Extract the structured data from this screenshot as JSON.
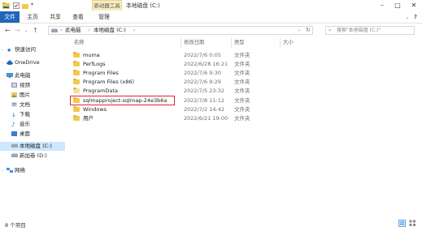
{
  "window": {
    "title": "本地磁盘 (C:)",
    "contextual_tab": "驱动器工具",
    "controls": {
      "minimize": "–",
      "maximize": "□",
      "close": "✕"
    }
  },
  "ribbon": {
    "tabs": [
      "文件",
      "主页",
      "共享",
      "查看",
      "管理"
    ]
  },
  "address": {
    "path": [
      "此电脑",
      "本地磁盘 (C:)"
    ],
    "search_placeholder": "搜索\"本地磁盘 (C:)\""
  },
  "nav": {
    "quick_access": "快速访问",
    "onedrive": "OneDrive",
    "this_pc": "此电脑",
    "items": [
      "视频",
      "图片",
      "文档",
      "下载",
      "音乐",
      "桌面",
      "本地磁盘 (C:)",
      "新加卷 (D:)"
    ],
    "network": "网络"
  },
  "list": {
    "headers": {
      "name": "名称",
      "date": "修改日期",
      "type": "类型",
      "size": "大小"
    },
    "rows": [
      {
        "name": "muma",
        "date": "2022/7/6 0:05",
        "type": "文件夹"
      },
      {
        "name": "PerfLogs",
        "date": "2022/6/28 16:21",
        "type": "文件夹"
      },
      {
        "name": "Program Files",
        "date": "2022/7/6 9:30",
        "type": "文件夹"
      },
      {
        "name": "Program Files (x86)",
        "date": "2022/7/6 9:29",
        "type": "文件夹"
      },
      {
        "name": "ProgramData",
        "date": "2022/7/5 23:32",
        "type": "文件夹"
      },
      {
        "name": "sqlmapproject-sqlmap-24e3b6a",
        "date": "2022/7/8 11:12",
        "type": "文件夹"
      },
      {
        "name": "Windows",
        "date": "2022/7/2 14:42",
        "type": "文件夹"
      },
      {
        "name": "用户",
        "date": "2022/6/21 19:00",
        "type": "文件夹"
      }
    ]
  },
  "status": {
    "count": "8 个项目"
  },
  "colors": {
    "accent": "#1f66b9",
    "highlight": "#e0262e",
    "selection": "#cde8ff",
    "folder": "#f2c94c"
  }
}
